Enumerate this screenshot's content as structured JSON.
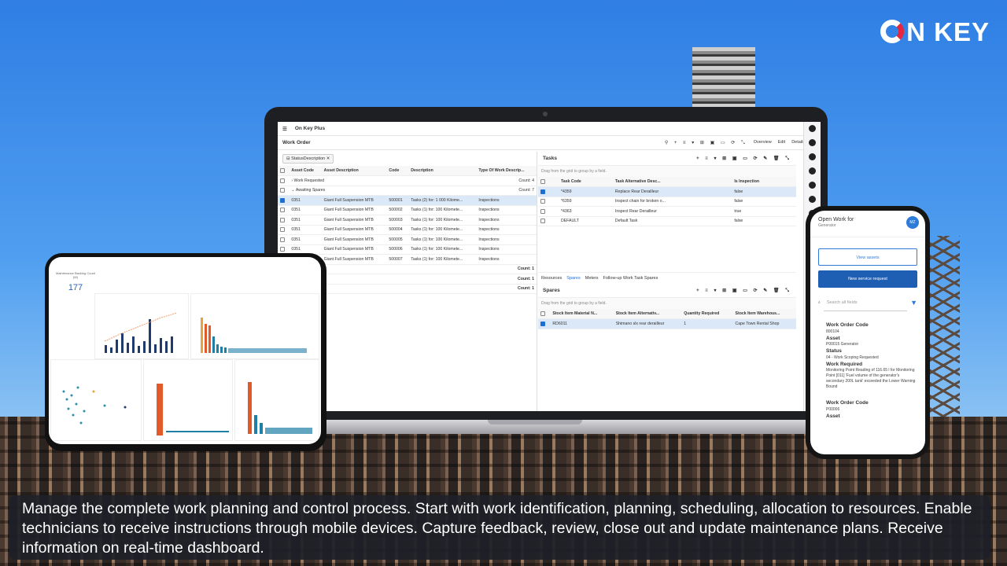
{
  "brand": {
    "logo_text": "N KEY",
    "accent": "#e5263d"
  },
  "app": {
    "title": "On Key Plus",
    "page_title": "Work Order",
    "actions": [
      "Overview",
      "Edit",
      "Details"
    ],
    "filter_chip": "StatusDescription",
    "columns": [
      "Asset Code",
      "Asset Description",
      "Code",
      "Description",
      "Type Of Work Descrip..."
    ],
    "groups": [
      {
        "label": "Work Requested",
        "count": "Count: 4"
      },
      {
        "label": "Awaiting Spares",
        "count": "Count: 7"
      }
    ],
    "rows": [
      {
        "asset": "0351",
        "desc": "Giant Full Suspension MTB",
        "code": "500001",
        "d": "Tasks (2) for: 1 000 Kilome...",
        "type": "Inspections",
        "sel": true
      },
      {
        "asset": "0351",
        "desc": "Giant Full Suspension MTB",
        "code": "500002",
        "d": "Tasks (1) for: 100 Kilomete...",
        "type": "Inspections"
      },
      {
        "asset": "0351",
        "desc": "Giant Full Suspension MTB",
        "code": "500003",
        "d": "Tasks (1) for: 100 Kilomete...",
        "type": "Inspections"
      },
      {
        "asset": "0351",
        "desc": "Giant Full Suspension MTB",
        "code": "500004",
        "d": "Tasks (1) for: 100 Kilomete...",
        "type": "Inspections"
      },
      {
        "asset": "0351",
        "desc": "Giant Full Suspension MTB",
        "code": "500005",
        "d": "Tasks (1) for: 100 Kilomete...",
        "type": "Inspections"
      },
      {
        "asset": "0351",
        "desc": "Giant Full Suspension MTB",
        "code": "500006",
        "d": "Tasks (1) for: 100 Kilomete...",
        "type": "Inspections"
      },
      {
        "asset": "0351",
        "desc": "Giant Full Suspension MTB",
        "code": "500007",
        "d": "Tasks (1) for: 100 Kilomete...",
        "type": "Inspections"
      }
    ],
    "extra_counts": [
      "Count: 1",
      "Count: 1",
      "Count: 1"
    ],
    "tasks": {
      "title": "Tasks",
      "drag_hint": "Drag from the grid to group by a field.",
      "columns": [
        "Task Code",
        "Task Alternative Desc...",
        "Is Inspection"
      ],
      "rows": [
        {
          "code": "*4359",
          "alt": "Replace Rear Derailleur",
          "insp": "false",
          "sel": true
        },
        {
          "code": "*6359",
          "alt": "Inspect chain for broken o...",
          "insp": "false"
        },
        {
          "code": "*4363",
          "alt": "Inspect Rear Derailleur",
          "insp": "true"
        },
        {
          "code": "DEFAULT",
          "alt": "Default Task",
          "insp": "false"
        }
      ]
    },
    "tabs": [
      "Resources",
      "Spares",
      "Meters",
      "Follow-up Work Task Spares"
    ],
    "spares": {
      "title": "Spares",
      "drag_hint": "Drag from the grid to group by a field.",
      "columns": [
        "Stock Item Material N...",
        "Stock Item Alternativ...",
        "Quantity Required",
        "Stock Item Warehous..."
      ],
      "rows": [
        {
          "mat": "RD6011",
          "alt": "Shimano slx rear derailleur",
          "qty": "1",
          "wh": "Cape Town Rental Shop"
        }
      ]
    },
    "laptop_label": "laptop mockup"
  },
  "tablet": {
    "kpi_label": "Maintenance Backlog Count (W)",
    "kpi_value": "177"
  },
  "phone": {
    "title": "Open Work for",
    "subtitle": "Generator",
    "avatar": "MZ",
    "btn_view": "View assets",
    "btn_new": "New service request",
    "search_placeholder": "Search all fields",
    "card1": {
      "woc_label": "Work Order Code",
      "woc": "800104",
      "asset_label": "Asset",
      "asset": "P00015 Generator",
      "status_label": "Status",
      "status": "04 - Work Scoping Requested",
      "wr_label": "Work Required",
      "wr": "Monitoring Point Reading of 116.65 l for Monitoring Point [011] 'Fuel volume of the generator's secondary 200L tank' exceeded the Lower Warning Bound"
    },
    "card2": {
      "woc_label": "Work Order Code",
      "woc": "P00006",
      "asset_label": "Asset"
    }
  },
  "caption": "Manage the complete work planning and control process. Start with work identification, planning, scheduling, allocation to resources. Enable technicians to receive instructions through mobile devices. Capture feedback, review, close out and update maintenance plans. Receive information on real-time dashboard."
}
